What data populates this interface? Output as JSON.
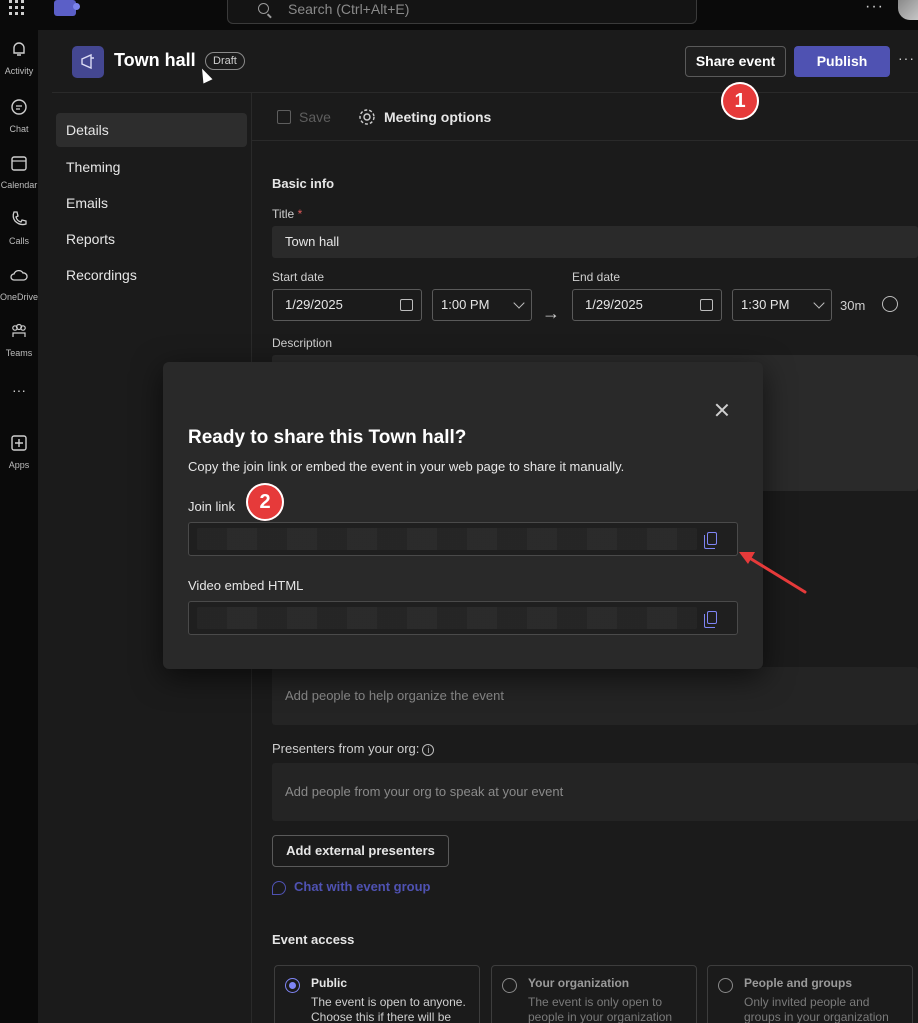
{
  "topbar": {
    "search_placeholder": "Search (Ctrl+Alt+E)",
    "more_label": "···"
  },
  "rail": {
    "items": [
      {
        "label": "Activity",
        "icon": "bell-icon"
      },
      {
        "label": "Chat",
        "icon": "chat-icon"
      },
      {
        "label": "Calendar",
        "icon": "calendar-icon"
      },
      {
        "label": "Calls",
        "icon": "phone-icon"
      },
      {
        "label": "OneDrive",
        "icon": "cloud-icon"
      },
      {
        "label": "Teams",
        "icon": "teams-icon"
      },
      {
        "label": "Apps",
        "icon": "apps-icon"
      }
    ],
    "more_label": "···"
  },
  "header": {
    "title": "Town hall",
    "badge": "Draft",
    "share_label": "Share event",
    "publish_label": "Publish",
    "more_label": "···"
  },
  "callouts": {
    "one": "1",
    "two": "2"
  },
  "menu": {
    "items": [
      {
        "label": "Details",
        "active": true
      },
      {
        "label": "Theming",
        "active": false
      },
      {
        "label": "Emails",
        "active": false
      },
      {
        "label": "Reports",
        "active": false
      },
      {
        "label": "Recordings",
        "active": false
      }
    ]
  },
  "toolbar": {
    "save_label": "Save",
    "options_label": "Meeting options"
  },
  "form": {
    "section_basic": "Basic info",
    "title_label": "Title",
    "required_mark": "*",
    "title_value": "Town hall",
    "start_label": "Start date",
    "start_date": "1/29/2025",
    "start_time": "1:00 PM",
    "end_label": "End date",
    "end_date": "1/29/2025",
    "end_time": "1:30 PM",
    "duration": "30m",
    "description_label": "Description",
    "organizers_placeholder": "Add people to help organize the event",
    "presenters_label": "Presenters from your org:",
    "presenters_placeholder": "Add people from your org to speak at your event",
    "external_btn": "Add external presenters",
    "chat_group_link": "Chat with event group",
    "access_title": "Event access",
    "access_options": [
      {
        "title": "Public",
        "desc": "The event is open to anyone. Choose this if there will be",
        "selected": true
      },
      {
        "title": "Your organization",
        "desc": "The event is only open to people in your organization",
        "selected": false
      },
      {
        "title": "People and groups",
        "desc": "Only invited people and groups in your organization",
        "selected": false
      }
    ]
  },
  "dialog": {
    "title": "Ready to share this Town hall?",
    "subtitle": "Copy the join link or embed the event in your web page to share it manually.",
    "join_label": "Join link",
    "embed_label": "Video embed HTML"
  },
  "colors": {
    "accent": "#4f52b2",
    "callout_red": "#e63a3a",
    "background": "#1b1b1b"
  }
}
